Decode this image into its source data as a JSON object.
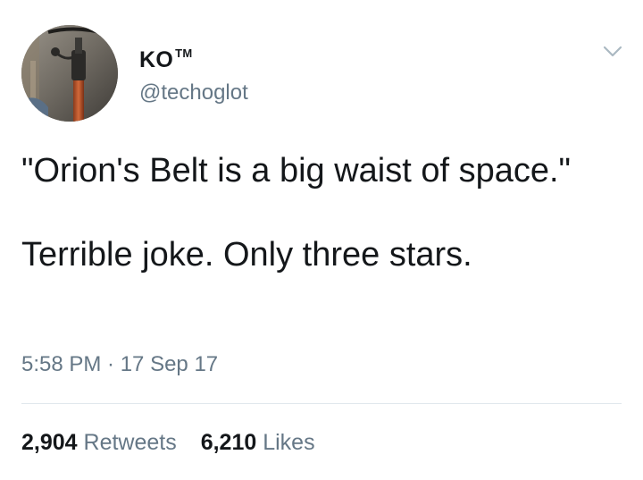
{
  "tweet": {
    "avatar_icon": "profile-photo",
    "display_name": "KO",
    "trademark": "TM",
    "handle": "@techoglot",
    "menu_icon": "chevron-down-icon",
    "text_line_1": "\"Orion's Belt is a big waist of space.\"",
    "text_line_2": "Terrible joke. Only three stars.",
    "timestamp": "5:58 PM · 17 Sep 17",
    "retweets_count": "2,904",
    "retweets_label": "Retweets",
    "likes_count": "6,210",
    "likes_label": "Likes"
  },
  "colors": {
    "text": "#14171a",
    "secondary": "#657786",
    "divider": "#e1e8ed"
  }
}
